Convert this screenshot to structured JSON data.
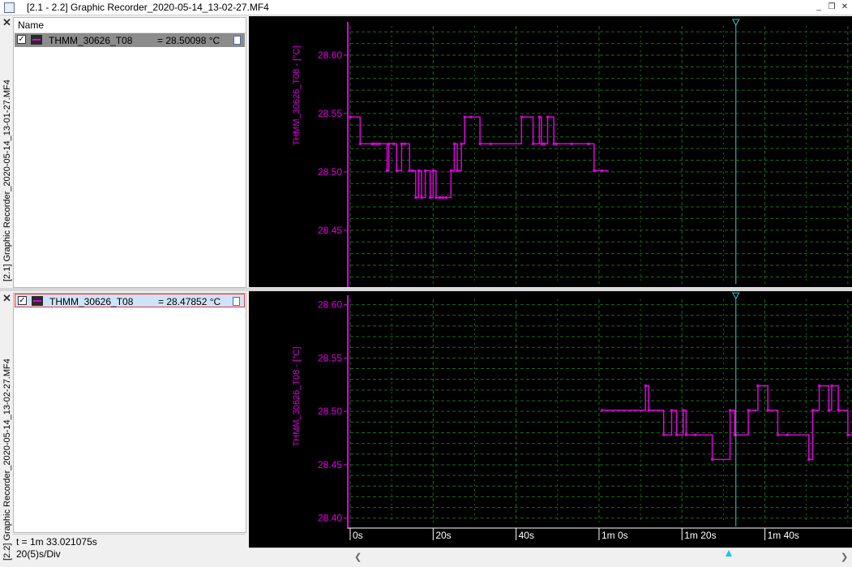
{
  "window": {
    "title": "[2.1 - 2.2] Graphic Recorder_2020-05-14_13-02-27.MF4",
    "minimize_icon": "minimize-icon",
    "restore_icon": "restore-icon",
    "close_icon": "close-icon"
  },
  "panes": [
    {
      "vertical_title": "[2.1] Graphic Recorder_2020-05-14_13-01-27.MF4",
      "list_header": "Name",
      "channel": {
        "name": "THMM_30626_T08",
        "value": "= 28.50098 °C",
        "checked": true
      }
    },
    {
      "vertical_title": "[2.2] Graphic Recorder_2020-05-14_13-02-27.MF4",
      "channel": {
        "name": "THMM_30626_T08",
        "value": "= 28.47852 °C",
        "checked": true
      },
      "status": {
        "time": "t = 1m 33.021075s",
        "division": "20(5)s/Div"
      }
    }
  ],
  "colors": {
    "signal": "#e000e0",
    "grid": "#1e6a1e",
    "cursor": "#40c8c8",
    "background": "#000000"
  },
  "chart_data": [
    {
      "type": "line",
      "ylabel": "THMM_30626_T08 - [°C]",
      "yticks": [
        "28.60",
        "28.55",
        "28.50",
        "28.45"
      ],
      "ylim": [
        28.404,
        28.625
      ],
      "xlim": [
        0,
        121
      ],
      "cursor_x": 93.0,
      "series": [
        {
          "x": [
            0,
            2.4,
            2.4,
            5.3,
            5.3,
            5.6,
            5.6,
            6.3,
            6.3,
            7,
            7,
            8.9,
            8.9,
            9.3,
            9.3,
            10.5,
            10.5,
            11.2,
            11.2,
            12.4,
            12.4,
            13.1,
            13.1,
            14.3,
            14.3,
            15,
            15,
            15.8,
            15.8,
            16.5,
            16.5,
            17.2,
            17.2,
            18.1,
            18.1,
            19.3,
            19.3,
            20,
            20,
            20.7,
            20.7,
            21.6,
            21.6,
            22.3,
            22.3,
            23.1,
            23.1,
            24.3,
            24.3,
            25.1,
            25.1,
            25.8,
            25.8,
            26.8,
            26.8,
            27.6,
            27.6,
            29.1,
            29.1,
            31.3,
            31.3,
            33.9,
            33.9,
            41.3,
            41.3,
            44.1,
            44.1,
            45.6,
            45.6,
            46.1,
            46.1,
            46.4,
            46.4,
            46.8,
            46.8,
            47.6,
            47.6,
            49.1,
            49.1,
            49.7,
            49.7,
            53.4,
            53.4,
            57.5,
            57.5,
            58.8,
            58.8,
            60.7,
            60.7,
            62.3
          ],
          "y": [
            28.547,
            28.547,
            28.524,
            28.524,
            28.524,
            28.524,
            28.524,
            28.524,
            28.524,
            28.524,
            28.524,
            28.524,
            28.501,
            28.501,
            28.524,
            28.524,
            28.524,
            28.524,
            28.501,
            28.501,
            28.524,
            28.524,
            28.524,
            28.524,
            28.501,
            28.501,
            28.501,
            28.501,
            28.478,
            28.478,
            28.501,
            28.501,
            28.478,
            28.478,
            28.501,
            28.501,
            28.478,
            28.478,
            28.501,
            28.501,
            28.478,
            28.478,
            28.478,
            28.478,
            28.478,
            28.478,
            28.478,
            28.478,
            28.501,
            28.501,
            28.524,
            28.524,
            28.501,
            28.501,
            28.524,
            28.524,
            28.547,
            28.547,
            28.547,
            28.547,
            28.524,
            28.524,
            28.524,
            28.524,
            28.547,
            28.547,
            28.524,
            28.524,
            28.547,
            28.547,
            28.524,
            28.524,
            28.524,
            28.524,
            28.524,
            28.524,
            28.547,
            28.547,
            28.524,
            28.524,
            28.524,
            28.524,
            28.524,
            28.524,
            28.524,
            28.524,
            28.501,
            28.501,
            28.501,
            28.501
          ]
        }
      ]
    },
    {
      "type": "line",
      "ylabel": "THMM_30626_T08 - [°C]",
      "yticks": [
        "28.60",
        "28.55",
        "28.50",
        "28.45",
        "28.40"
      ],
      "xticks": [
        "0s",
        "20s",
        "40s",
        "1m 0s",
        "1m 20s",
        "1m 40s"
      ],
      "ylim": [
        28.396,
        28.605
      ],
      "xlim": [
        0,
        121
      ],
      "cursor_x": 93.0,
      "series": [
        {
          "x": [
            60.7,
            71.2,
            71.2,
            72,
            72,
            75.6,
            75.6,
            77.5,
            77.5,
            78.7,
            78.7,
            80.3,
            80.3,
            81,
            81,
            83.2,
            83.2,
            87.3,
            87.3,
            91.6,
            91.6,
            92.7,
            92.7,
            96,
            96,
            98.3,
            98.3,
            100.7,
            100.7,
            103.1,
            103.1,
            105.4,
            105.4,
            110.6,
            110.6,
            111.5,
            111.5,
            113.1,
            113.1,
            115.4,
            115.4,
            116.1,
            116.1,
            117.7,
            117.7,
            120,
            120,
            121
          ],
          "y": [
            28.501,
            28.501,
            28.524,
            28.524,
            28.501,
            28.501,
            28.478,
            28.478,
            28.501,
            28.501,
            28.478,
            28.478,
            28.501,
            28.501,
            28.478,
            28.478,
            28.478,
            28.478,
            28.455,
            28.455,
            28.501,
            28.501,
            28.478,
            28.478,
            28.501,
            28.501,
            28.524,
            28.524,
            28.501,
            28.501,
            28.478,
            28.478,
            28.478,
            28.478,
            28.455,
            28.455,
            28.501,
            28.501,
            28.524,
            28.524,
            28.501,
            28.501,
            28.524,
            28.524,
            28.501,
            28.501,
            28.478,
            28.478
          ]
        }
      ]
    }
  ]
}
